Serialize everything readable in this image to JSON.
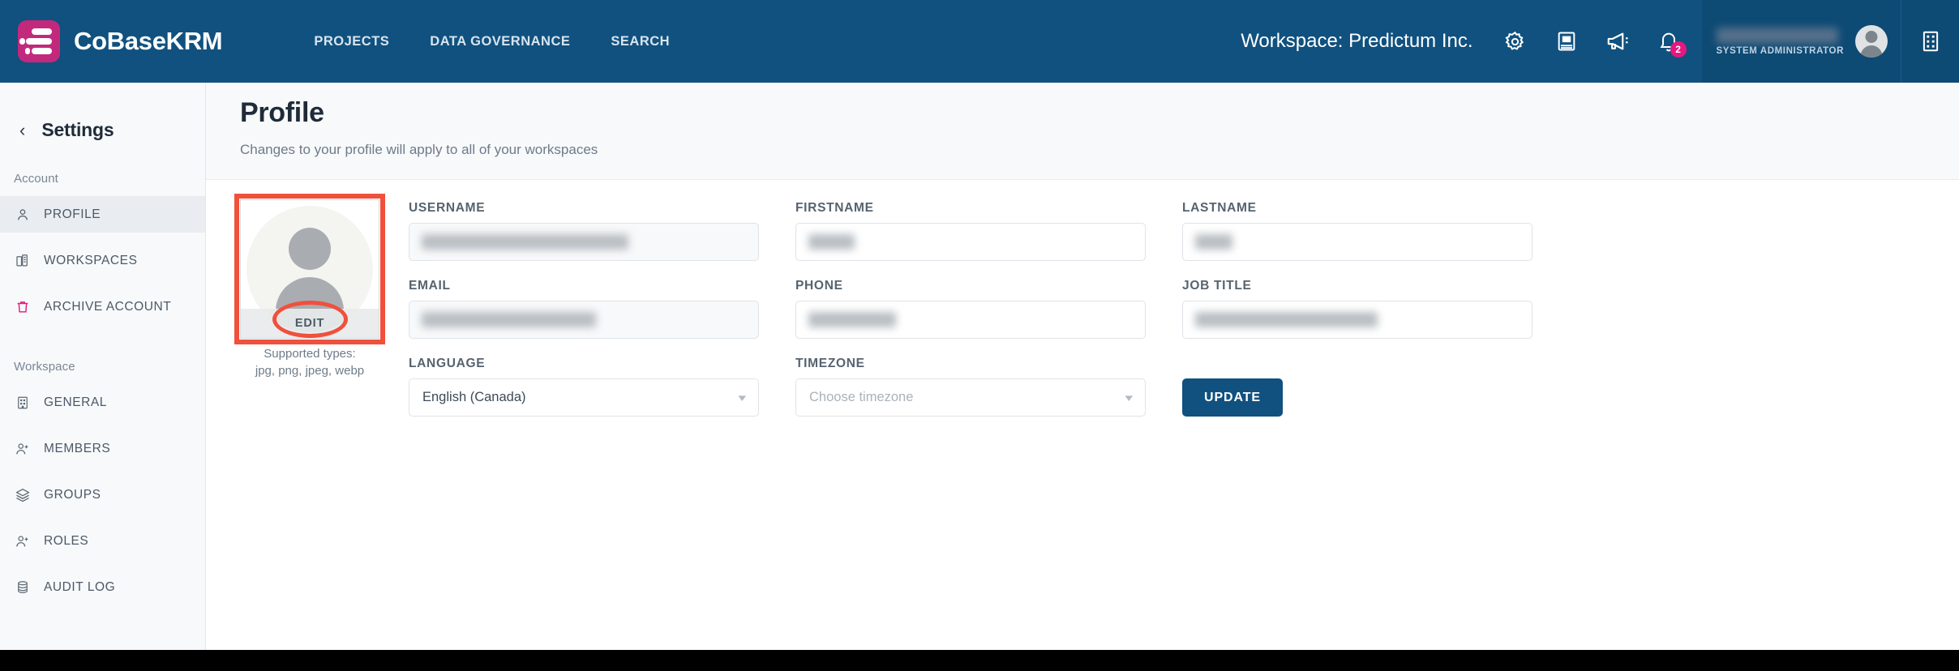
{
  "brand": {
    "name": "CoBaseKRM",
    "logo_icon": "cobase-logo-icon",
    "accent": "#c2297c"
  },
  "topnav": {
    "background": "#10517f",
    "links": [
      {
        "label": "PROJECTS",
        "name": "projects"
      },
      {
        "label": "DATA GOVERNANCE",
        "name": "data-governance"
      },
      {
        "label": "SEARCH",
        "name": "search"
      }
    ],
    "workspace_label": "Workspace: Predictum Inc.",
    "icons": [
      {
        "name": "gear-icon"
      },
      {
        "name": "book-icon"
      },
      {
        "name": "megaphone-icon"
      },
      {
        "name": "bell-icon"
      }
    ],
    "notification_count": "2",
    "user": {
      "name_redacted": true,
      "role": "SYSTEM ADMINISTRATOR",
      "avatar_icon": "avatar-icon"
    },
    "org_icon": "building-icon"
  },
  "sidebar": {
    "back_icon": "chevron-left-icon",
    "title": "Settings",
    "groups": [
      {
        "label": "Account",
        "items": [
          {
            "label": "PROFILE",
            "icon": "user-icon",
            "active": true
          },
          {
            "label": "WORKSPACES",
            "icon": "buildings-icon",
            "active": false
          },
          {
            "label": "ARCHIVE ACCOUNT",
            "icon": "trash-icon",
            "active": false,
            "icon_color": "#e3197f"
          }
        ]
      },
      {
        "label": "Workspace",
        "items": [
          {
            "label": "GENERAL",
            "icon": "building-icon",
            "active": false
          },
          {
            "label": "MEMBERS",
            "icon": "user-plus-icon",
            "active": false
          },
          {
            "label": "GROUPS",
            "icon": "layers-icon",
            "active": false
          },
          {
            "label": "ROLES",
            "icon": "user-plus-icon",
            "active": false
          },
          {
            "label": "AUDIT LOG",
            "icon": "database-icon",
            "active": false
          }
        ]
      }
    ]
  },
  "main": {
    "title": "Profile",
    "subtitle": "Changes to your profile will apply to all of your workspaces",
    "avatar": {
      "icon": "avatar-placeholder-icon",
      "edit_label": "EDIT",
      "supported_line1": "Supported types:",
      "supported_line2": "jpg, png, jpeg, webp"
    },
    "fields": [
      {
        "label": "USERNAME",
        "name": "username-field",
        "value_redacted": true,
        "disabled": true,
        "width_class": "w-username"
      },
      {
        "label": "FIRSTNAME",
        "name": "firstname-field",
        "value_redacted": true,
        "disabled": false,
        "width_class": "w-firstname"
      },
      {
        "label": "LASTNAME",
        "name": "lastname-field",
        "value_redacted": true,
        "disabled": false,
        "width_class": "w-lastname"
      },
      {
        "label": "EMAIL",
        "name": "email-field",
        "value_redacted": true,
        "disabled": true,
        "width_class": "w-email"
      },
      {
        "label": "PHONE",
        "name": "phone-field",
        "value_redacted": true,
        "disabled": false,
        "width_class": "w-phone"
      },
      {
        "label": "JOB TITLE",
        "name": "jobtitle-field",
        "value_redacted": true,
        "disabled": false,
        "width_class": "w-jobtitle"
      }
    ],
    "language": {
      "label": "LANGUAGE",
      "value": "English (Canada)",
      "is_placeholder": false
    },
    "timezone": {
      "label": "TIMEZONE",
      "value": "Choose timezone",
      "is_placeholder": true
    },
    "update_button": {
      "label": "UPDATE",
      "color": "#10517f"
    }
  },
  "annotations": {
    "color": "#f0503c",
    "rect_target": "avatar-upload-box",
    "ellipse_target": "avatar-edit-button"
  }
}
